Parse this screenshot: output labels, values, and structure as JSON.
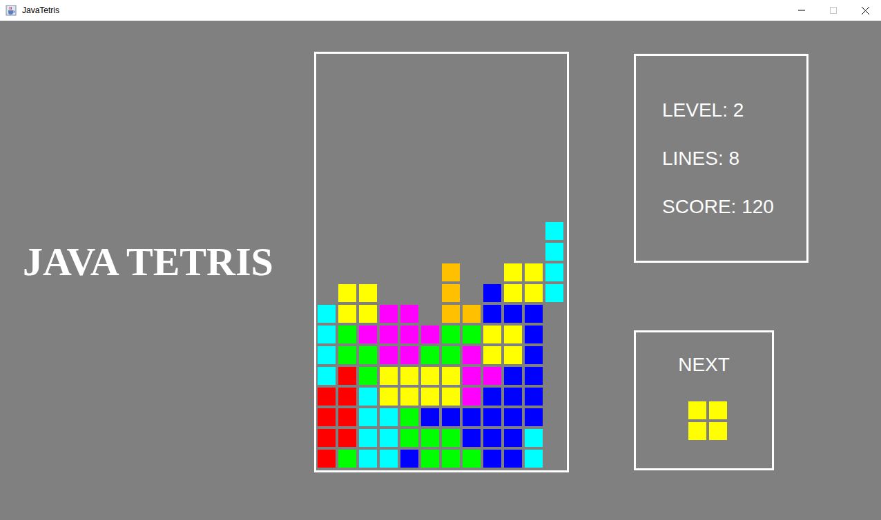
{
  "window": {
    "title": "JavaTetris",
    "maximize_enabled": false
  },
  "title": "JAVA TETRIS",
  "board": {
    "rows": [
      [
        null,
        null,
        null,
        null,
        null,
        null,
        null,
        null,
        null,
        null,
        null,
        null
      ],
      [
        null,
        null,
        null,
        null,
        null,
        null,
        null,
        null,
        null,
        null,
        null,
        null
      ],
      [
        null,
        null,
        null,
        null,
        null,
        null,
        null,
        null,
        null,
        null,
        null,
        null
      ],
      [
        null,
        null,
        null,
        null,
        null,
        null,
        null,
        null,
        null,
        null,
        null,
        null
      ],
      [
        null,
        null,
        null,
        null,
        null,
        null,
        null,
        null,
        null,
        null,
        null,
        null
      ],
      [
        null,
        null,
        null,
        null,
        null,
        null,
        null,
        null,
        null,
        null,
        null,
        null
      ],
      [
        null,
        null,
        null,
        null,
        null,
        null,
        null,
        null,
        null,
        null,
        null,
        null
      ],
      [
        null,
        null,
        null,
        null,
        null,
        null,
        null,
        null,
        null,
        null,
        null,
        null
      ],
      [
        null,
        null,
        null,
        null,
        null,
        null,
        null,
        null,
        null,
        null,
        null,
        "#00ffff"
      ],
      [
        null,
        null,
        null,
        null,
        null,
        null,
        null,
        null,
        null,
        null,
        null,
        "#00ffff"
      ],
      [
        null,
        null,
        null,
        null,
        null,
        null,
        "#ffc000",
        null,
        null,
        "#ffff00",
        "#ffff00",
        "#00ffff"
      ],
      [
        null,
        "#ffff00",
        "#ffff00",
        null,
        null,
        null,
        "#ffc000",
        null,
        "#0000ff",
        "#ffff00",
        "#ffff00",
        "#00ffff"
      ],
      [
        "#00ffff",
        "#ffff00",
        "#ffff00",
        "#ff00ff",
        "#ff00ff",
        null,
        "#ffc000",
        "#ffc000",
        "#0000ff",
        "#0000ff",
        "#0000ff",
        null
      ],
      [
        "#00ffff",
        "#00ff00",
        "#ff00ff",
        "#ff00ff",
        "#ff00ff",
        "#ff00ff",
        "#00ff00",
        "#00ff00",
        "#ffff00",
        "#ffff00",
        "#0000ff",
        null
      ],
      [
        "#00ffff",
        "#00ff00",
        "#00ff00",
        "#ff00ff",
        "#ff00ff",
        "#00ff00",
        "#00ff00",
        "#ff00ff",
        "#ffff00",
        "#ffff00",
        "#0000ff",
        null
      ],
      [
        "#00ffff",
        "#ff0000",
        "#00ff00",
        "#ffff00",
        "#ffff00",
        "#ffff00",
        "#ffff00",
        "#ff00ff",
        "#ff00ff",
        "#0000ff",
        "#0000ff",
        null
      ],
      [
        "#ff0000",
        "#ff0000",
        "#00ffff",
        "#ffff00",
        "#ffff00",
        "#ffff00",
        "#ffff00",
        "#ff00ff",
        "#0000ff",
        "#0000ff",
        "#0000ff",
        null
      ],
      [
        "#ff0000",
        "#ff0000",
        "#00ffff",
        "#00ffff",
        "#00ff00",
        "#0000ff",
        "#0000ff",
        "#0000ff",
        "#0000ff",
        "#0000ff",
        "#0000ff",
        null
      ],
      [
        "#ff0000",
        "#ff0000",
        "#00ffff",
        "#00ffff",
        "#00ff00",
        "#00ff00",
        "#00ff00",
        "#0000ff",
        "#0000ff",
        "#0000ff",
        "#00ffff",
        null
      ],
      [
        "#ff0000",
        "#00ff00",
        "#00ffff",
        "#00ffff",
        "#0000ff",
        "#00ff00",
        "#00ff00",
        "#00ff00",
        "#0000ff",
        "#0000ff",
        "#00ffff",
        null
      ]
    ]
  },
  "stats": [
    {
      "text": "LEVEL: 2"
    },
    {
      "text": "LINES: 8"
    },
    {
      "text": "SCORE: 120"
    }
  ],
  "next": {
    "label": "NEXT",
    "cells": [
      [
        "#ffff00",
        "#ffff00"
      ],
      [
        "#ffff00",
        "#ffff00"
      ]
    ]
  }
}
